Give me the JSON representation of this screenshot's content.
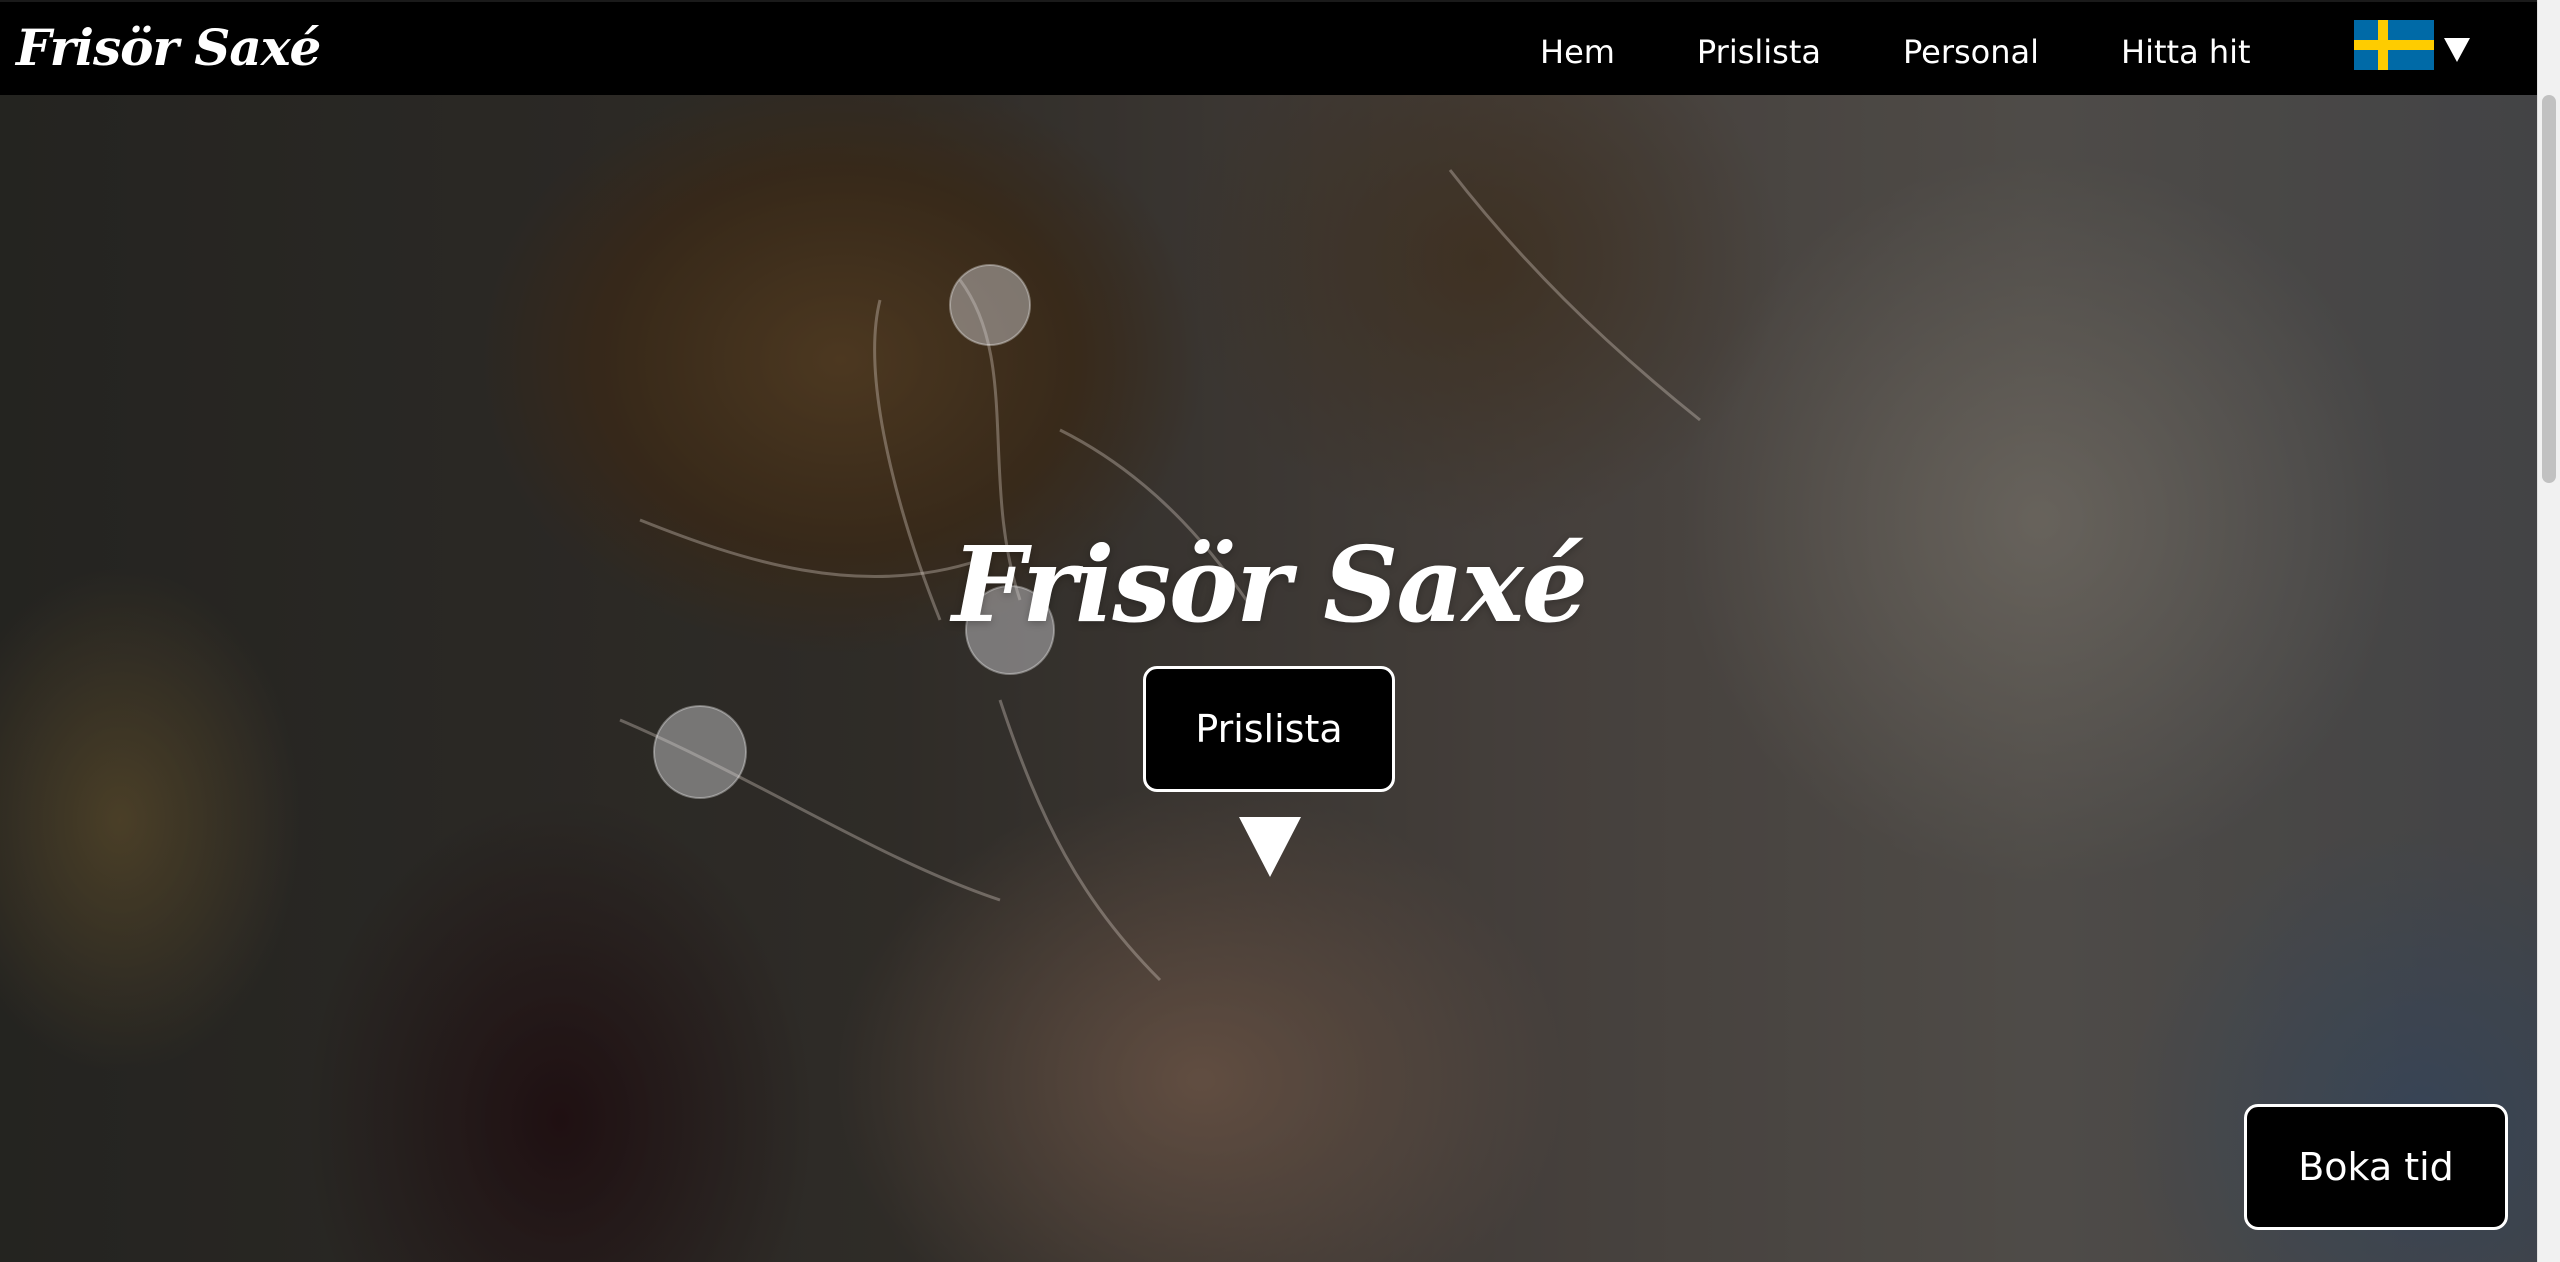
{
  "header": {
    "logo_text": "Frisör Saxé",
    "nav": [
      "Hem",
      "Prislista",
      "Personal",
      "Hitta hit"
    ],
    "language": {
      "flag_icon": "sweden-flag-icon",
      "caret_icon": "caret-down-icon"
    }
  },
  "hero": {
    "title": "Frisör Saxé",
    "cta_label": "Prislista",
    "scroll_icon": "triangle-down-icon"
  },
  "booking": {
    "button_label": "Boka tid"
  },
  "colors": {
    "navbar_bg": "#000000",
    "button_bg": "#000000",
    "button_border": "#ffffff",
    "flag_blue": "#006aa7",
    "flag_yellow": "#fecc00"
  }
}
